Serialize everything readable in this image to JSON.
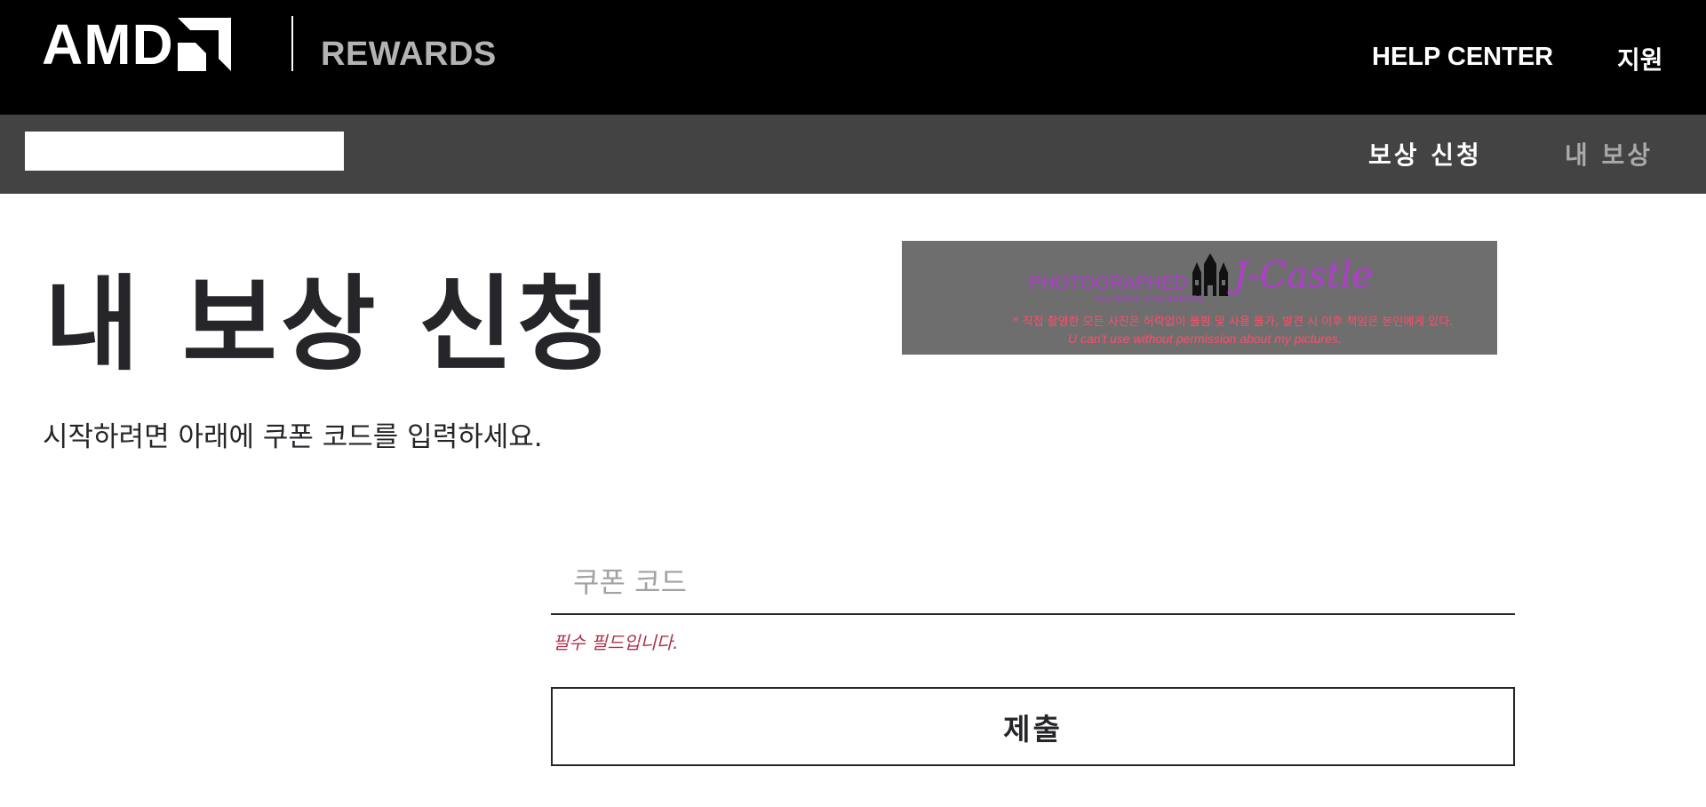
{
  "header": {
    "logo_text": "AMD",
    "logo_icon": "amd-arrow-logo",
    "section_label": "REWARDS",
    "nav": {
      "help_center": "HELP CENTER",
      "support": "지원"
    }
  },
  "subnav": {
    "items": [
      {
        "label": "보상 신청",
        "active": true
      },
      {
        "label": "내 보상",
        "active": false
      }
    ]
  },
  "main": {
    "title": "내 보상 신청",
    "subtitle": "시작하려면 아래에 쿠폰 코드를 입력하세요.",
    "banner": {
      "photographed": "PHOTOGRAPHED",
      "brand": "J-Castle",
      "tagline": "ALL RIGHTS RESERVED",
      "warning": "* 직접 촬영한 모든 사진은 허락없이 불펌 및 사용 불가, 발견 시 이후 책임은 본인에게 있다.",
      "english": "U can't use without permission about my pictures."
    },
    "form": {
      "coupon_value": "",
      "coupon_placeholder": "쿠폰 코드",
      "error": "필수 필드입니다.",
      "submit_label": "제출"
    }
  },
  "colors": {
    "topbar": "#000000",
    "subnav": "#434343",
    "text": "#26262a",
    "error": "#b0304a",
    "banner_bg": "#6e6e6e",
    "banner_accent": "#b23bd0",
    "banner_warning": "#ff4d6a"
  }
}
